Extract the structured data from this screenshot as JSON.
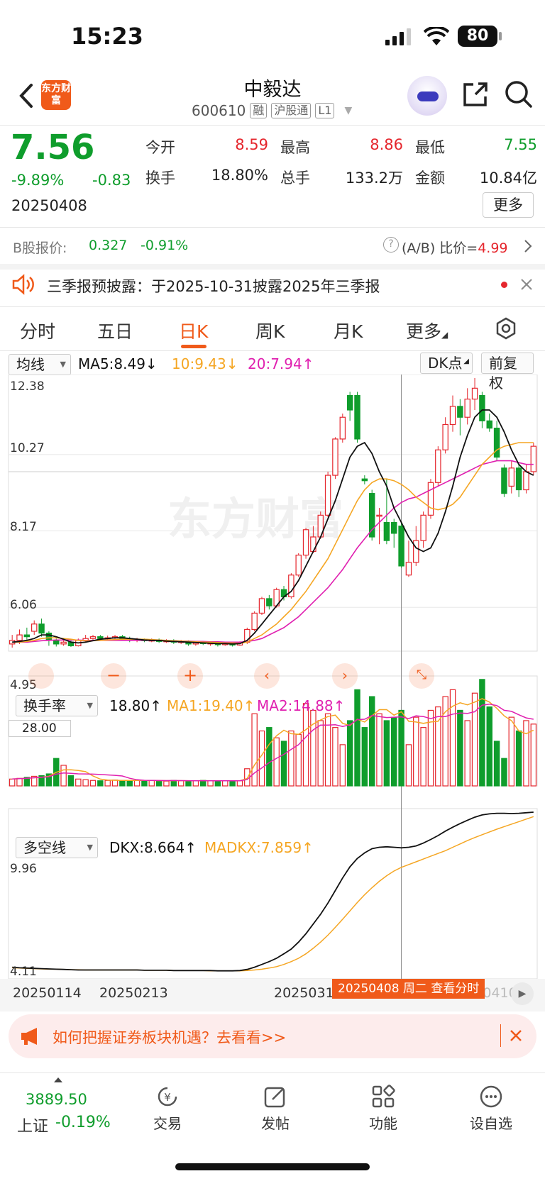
{
  "status": {
    "time": "15:23",
    "battery": "80"
  },
  "stock": {
    "name": "中毅达",
    "code": "600610",
    "tags": [
      "融",
      "沪股通",
      "L1"
    ],
    "logo_text": "东方财富",
    "price": "7.56",
    "change_pct": "-9.89%",
    "change_amt": "-0.83",
    "date": "20250408",
    "quote": [
      {
        "label": "今开",
        "value": "8.59",
        "color": "#e5262d"
      },
      {
        "label": "最高",
        "value": "8.86",
        "color": "#e5262d"
      },
      {
        "label": "最低",
        "value": "7.55",
        "color": "#0f9d2c"
      },
      {
        "label": "换手",
        "value": "18.80%",
        "color": "#222222"
      },
      {
        "label": "总手",
        "value": "133.2万",
        "color": "#222222"
      },
      {
        "label": "金额",
        "value": "10.84亿",
        "color": "#222222"
      }
    ],
    "more_label": "更多",
    "b_share_label": "B股报价:",
    "b_share_price": "0.327",
    "b_share_pct": "-0.91%",
    "ab_label": "(A/B) 比价=",
    "ab_value": "4.99"
  },
  "notice": {
    "text": "三季报预披露：于2025-10-31披露2025年三季报"
  },
  "tabs": [
    "分时",
    "五日",
    "日K",
    "周K",
    "月K",
    "更多"
  ],
  "active_tab": "日K",
  "kline": {
    "indicator_select": "均线",
    "ma5": "MA5:8.49↓",
    "ma10": "10:9.43↓",
    "ma20": "20:7.94↑",
    "dk_button": "DK点",
    "adjust_button": "前复权",
    "y_ticks": [
      "12.38",
      "10.27",
      "8.17",
      "6.06",
      "4.95"
    ],
    "watermark": "东方财富"
  },
  "turnover": {
    "select": "换手率",
    "value": "18.80↑",
    "ma1": "MA1:19.40↑",
    "ma2": "MA2:14.88↑",
    "y_max": "28.00"
  },
  "dkx": {
    "select": "多空线",
    "value": "DKX:8.664↑",
    "madkx": "MADKX:7.859↑",
    "y_max": "9.96",
    "y_min": "4.11"
  },
  "x_axis": {
    "labels": [
      "20250114",
      "20250213",
      "20250310",
      "20250410"
    ],
    "cursor_label": "20250408 周二 查看分时"
  },
  "banner": {
    "text": "如何把握证券板块机遇？去看看>>"
  },
  "bottom": {
    "index_value": "3889.50",
    "index_name": "上证",
    "index_pct": "-0.19%",
    "items": [
      "交易",
      "发帖",
      "功能",
      "设自选"
    ]
  },
  "colors": {
    "up": "#e5262d",
    "down": "#0f9d2c",
    "accent": "#f05a1a",
    "ma5": "#111111",
    "ma10": "#f5a623",
    "ma20": "#e020b0"
  },
  "chart_data": {
    "type": "candlestick",
    "ylim": [
      4.95,
      12.38
    ],
    "candles": [
      [
        5.05,
        5.15,
        5.3,
        4.95
      ],
      [
        5.15,
        5.3,
        5.45,
        5.05
      ],
      [
        5.3,
        5.25,
        5.5,
        5.15
      ],
      [
        5.4,
        5.6,
        5.7,
        5.3
      ],
      [
        5.6,
        5.35,
        5.75,
        5.25
      ],
      [
        5.35,
        5.15,
        5.4,
        5.0
      ],
      [
        5.15,
        5.05,
        5.2,
        4.98
      ],
      [
        5.05,
        5.1,
        5.2,
        5.0
      ],
      [
        5.1,
        5.0,
        5.15,
        4.97
      ],
      [
        5.0,
        5.15,
        5.2,
        4.98
      ],
      [
        5.15,
        5.2,
        5.3,
        5.1
      ],
      [
        5.2,
        5.25,
        5.3,
        5.15
      ],
      [
        5.25,
        5.2,
        5.3,
        5.15
      ],
      [
        5.2,
        5.22,
        5.28,
        5.15
      ],
      [
        5.22,
        5.25,
        5.3,
        5.18
      ],
      [
        5.25,
        5.2,
        5.3,
        5.15
      ],
      [
        5.2,
        5.15,
        5.25,
        5.1
      ],
      [
        5.15,
        5.18,
        5.22,
        5.1
      ],
      [
        5.18,
        5.14,
        5.2,
        5.1
      ],
      [
        5.14,
        5.16,
        5.2,
        5.1
      ],
      [
        5.16,
        5.12,
        5.2,
        5.08
      ],
      [
        5.12,
        5.14,
        5.18,
        5.08
      ],
      [
        5.14,
        5.1,
        5.18,
        5.05
      ],
      [
        5.1,
        5.12,
        5.16,
        5.05
      ],
      [
        5.12,
        5.05,
        5.15,
        5.0
      ],
      [
        5.05,
        5.1,
        5.12,
        5.0
      ],
      [
        5.1,
        5.06,
        5.12,
        5.02
      ],
      [
        5.06,
        5.08,
        5.1,
        5.0
      ],
      [
        5.08,
        5.03,
        5.1,
        4.98
      ],
      [
        5.03,
        5.06,
        5.1,
        5.0
      ],
      [
        5.06,
        5.02,
        5.1,
        4.98
      ],
      [
        5.02,
        5.1,
        5.12,
        5.0
      ],
      [
        5.1,
        5.45,
        5.5,
        5.05
      ],
      [
        5.45,
        5.9,
        5.95,
        5.4
      ],
      [
        5.9,
        6.3,
        6.35,
        5.85
      ],
      [
        6.3,
        6.1,
        6.4,
        6.0
      ],
      [
        6.1,
        6.55,
        6.6,
        6.05
      ],
      [
        6.55,
        6.35,
        6.65,
        6.25
      ],
      [
        6.35,
        6.95,
        7.0,
        6.3
      ],
      [
        6.95,
        7.5,
        7.55,
        6.9
      ],
      [
        7.5,
        8.2,
        8.25,
        7.4
      ],
      [
        7.6,
        8.0,
        8.3,
        7.55
      ],
      [
        8.0,
        8.6,
        8.7,
        7.95
      ],
      [
        8.6,
        9.7,
        9.8,
        8.55
      ],
      [
        9.7,
        10.7,
        10.75,
        9.6
      ],
      [
        10.7,
        11.3,
        11.4,
        10.6
      ],
      [
        11.9,
        11.5,
        12.0,
        11.2
      ],
      [
        11.9,
        10.7,
        12.0,
        10.6
      ],
      [
        9.6,
        9.55,
        9.7,
        9.45
      ],
      [
        9.2,
        8.0,
        9.3,
        7.9
      ],
      [
        8.6,
        8.6,
        8.8,
        7.8
      ],
      [
        8.4,
        7.9,
        9.6,
        7.8
      ],
      [
        8.4,
        8.1,
        8.5,
        7.7
      ],
      [
        8.3,
        7.2,
        8.4,
        7.15
      ],
      [
        6.95,
        7.3,
        7.9,
        6.9
      ],
      [
        7.3,
        7.9,
        8.3,
        7.2
      ],
      [
        7.9,
        8.6,
        8.7,
        7.7
      ],
      [
        8.6,
        9.5,
        9.6,
        8.5
      ],
      [
        9.5,
        10.4,
        10.5,
        9.4
      ],
      [
        10.4,
        11.1,
        11.3,
        10.3
      ],
      [
        11.1,
        11.6,
        11.9,
        10.9
      ],
      [
        11.6,
        11.3,
        11.8,
        10.8
      ],
      [
        11.3,
        11.8,
        12.1,
        11.1
      ],
      [
        11.8,
        12.1,
        12.38,
        11.5
      ],
      [
        11.9,
        11.2,
        12.0,
        11.0
      ],
      [
        11.2,
        11.0,
        11.4,
        10.9
      ],
      [
        11.0,
        10.2,
        11.2,
        10.1
      ],
      [
        9.9,
        9.2,
        10.0,
        9.1
      ],
      [
        9.4,
        9.9,
        10.1,
        9.2
      ],
      [
        9.9,
        9.3,
        10.0,
        9.1
      ],
      [
        9.3,
        9.8,
        10.0,
        9.2
      ],
      [
        9.8,
        10.5,
        10.6,
        9.7
      ]
    ],
    "ma5": [
      5.1,
      5.12,
      5.15,
      5.2,
      5.3,
      5.3,
      5.25,
      5.18,
      5.1,
      5.08,
      5.1,
      5.14,
      5.18,
      5.2,
      5.22,
      5.22,
      5.2,
      5.18,
      5.16,
      5.15,
      5.15,
      5.13,
      5.12,
      5.11,
      5.1,
      5.09,
      5.08,
      5.07,
      5.06,
      5.06,
      5.05,
      5.06,
      5.15,
      5.35,
      5.6,
      5.85,
      6.1,
      6.35,
      6.5,
      6.8,
      7.2,
      7.6,
      8.0,
      8.5,
      9.0,
      9.6,
      10.2,
      10.5,
      10.6,
      10.3,
      9.8,
      9.4,
      8.8,
      8.4,
      8.0,
      7.7,
      7.6,
      7.7,
      8.1,
      8.7,
      9.4,
      10.2,
      10.8,
      11.3,
      11.5,
      11.5,
      11.3,
      10.9,
      10.4,
      10.0,
      9.8,
      9.7
    ],
    "ma10": [
      5.1,
      5.1,
      5.12,
      5.15,
      5.2,
      5.22,
      5.22,
      5.2,
      5.18,
      5.15,
      5.14,
      5.14,
      5.15,
      5.16,
      5.17,
      5.18,
      5.18,
      5.18,
      5.18,
      5.17,
      5.16,
      5.15,
      5.14,
      5.13,
      5.12,
      5.11,
      5.1,
      5.1,
      5.09,
      5.08,
      5.08,
      5.07,
      5.1,
      5.2,
      5.3,
      5.45,
      5.6,
      5.8,
      6.0,
      6.25,
      6.5,
      6.8,
      7.1,
      7.4,
      7.8,
      8.2,
      8.6,
      9.0,
      9.3,
      9.5,
      9.6,
      9.6,
      9.55,
      9.45,
      9.3,
      9.1,
      8.95,
      8.8,
      8.75,
      8.8,
      8.9,
      9.1,
      9.4,
      9.7,
      10.0,
      10.2,
      10.4,
      10.5,
      10.55,
      10.6,
      10.6,
      10.6
    ],
    "ma20": [
      5.1,
      5.1,
      5.1,
      5.12,
      5.14,
      5.15,
      5.16,
      5.16,
      5.16,
      5.16,
      5.15,
      5.15,
      5.15,
      5.15,
      5.15,
      5.15,
      5.15,
      5.15,
      5.15,
      5.15,
      5.15,
      5.14,
      5.14,
      5.13,
      5.13,
      5.12,
      5.12,
      5.11,
      5.11,
      5.1,
      5.1,
      5.1,
      5.12,
      5.15,
      5.2,
      5.3,
      5.4,
      5.5,
      5.65,
      5.8,
      6.0,
      6.2,
      6.4,
      6.6,
      6.85,
      7.1,
      7.4,
      7.7,
      7.95,
      8.2,
      8.4,
      8.6,
      8.8,
      8.95,
      9.05,
      9.1,
      9.2,
      9.3,
      9.4,
      9.5,
      9.6,
      9.7,
      9.8,
      9.9,
      10.0,
      10.05,
      10.1,
      10.1,
      10.1,
      10.05,
      10.0,
      10.0
    ],
    "turnover": [
      2,
      2.2,
      2.5,
      2.8,
      3,
      3.5,
      8,
      6,
      3,
      2,
      1.8,
      1.6,
      1.5,
      1.6,
      1.7,
      1.6,
      1.5,
      1.6,
      1.5,
      1.6,
      1.5,
      1.4,
      1.6,
      1.5,
      1.4,
      1.5,
      1.6,
      1.5,
      1.4,
      1.5,
      1.4,
      1.5,
      5,
      21,
      16,
      17,
      14,
      13,
      16,
      15,
      24,
      22,
      19,
      21,
      17,
      12,
      19,
      28,
      17,
      26,
      21,
      19,
      20,
      22,
      12,
      20,
      17,
      22,
      23,
      26,
      28,
      22,
      19,
      27,
      31,
      23,
      13,
      8,
      20,
      16,
      19,
      18
    ],
    "dkx": [
      4.4,
      4.38,
      4.37,
      4.36,
      4.35,
      4.34,
      4.33,
      4.32,
      4.31,
      4.3,
      4.3,
      4.3,
      4.3,
      4.3,
      4.3,
      4.3,
      4.3,
      4.3,
      4.29,
      4.29,
      4.29,
      4.29,
      4.28,
      4.28,
      4.28,
      4.28,
      4.28,
      4.28,
      4.27,
      4.27,
      4.27,
      4.28,
      4.32,
      4.4,
      4.5,
      4.6,
      4.72,
      4.88,
      5.05,
      5.3,
      5.6,
      5.95,
      6.3,
      6.7,
      7.15,
      7.6,
      8.0,
      8.3,
      8.5,
      8.65,
      8.7,
      8.72,
      8.7,
      8.68,
      8.7,
      8.75,
      8.85,
      8.98,
      9.12,
      9.28,
      9.42,
      9.55,
      9.67,
      9.78,
      9.86,
      9.9,
      9.92,
      9.92,
      9.91,
      9.92,
      9.94,
      9.96
    ],
    "madkx": [
      4.38,
      4.37,
      4.36,
      4.35,
      4.34,
      4.33,
      4.33,
      4.32,
      4.31,
      4.31,
      4.3,
      4.3,
      4.3,
      4.3,
      4.3,
      4.3,
      4.3,
      4.3,
      4.29,
      4.29,
      4.29,
      4.29,
      4.28,
      4.28,
      4.28,
      4.28,
      4.28,
      4.27,
      4.27,
      4.27,
      4.27,
      4.27,
      4.28,
      4.3,
      4.33,
      4.37,
      4.42,
      4.5,
      4.6,
      4.72,
      4.88,
      5.08,
      5.3,
      5.55,
      5.83,
      6.12,
      6.42,
      6.72,
      7.0,
      7.25,
      7.48,
      7.68,
      7.85,
      7.98,
      8.08,
      8.18,
      8.28,
      8.38,
      8.48,
      8.58,
      8.7,
      8.82,
      8.94,
      9.05,
      9.15,
      9.25,
      9.35,
      9.44,
      9.53,
      9.62,
      9.71,
      9.8
    ]
  }
}
